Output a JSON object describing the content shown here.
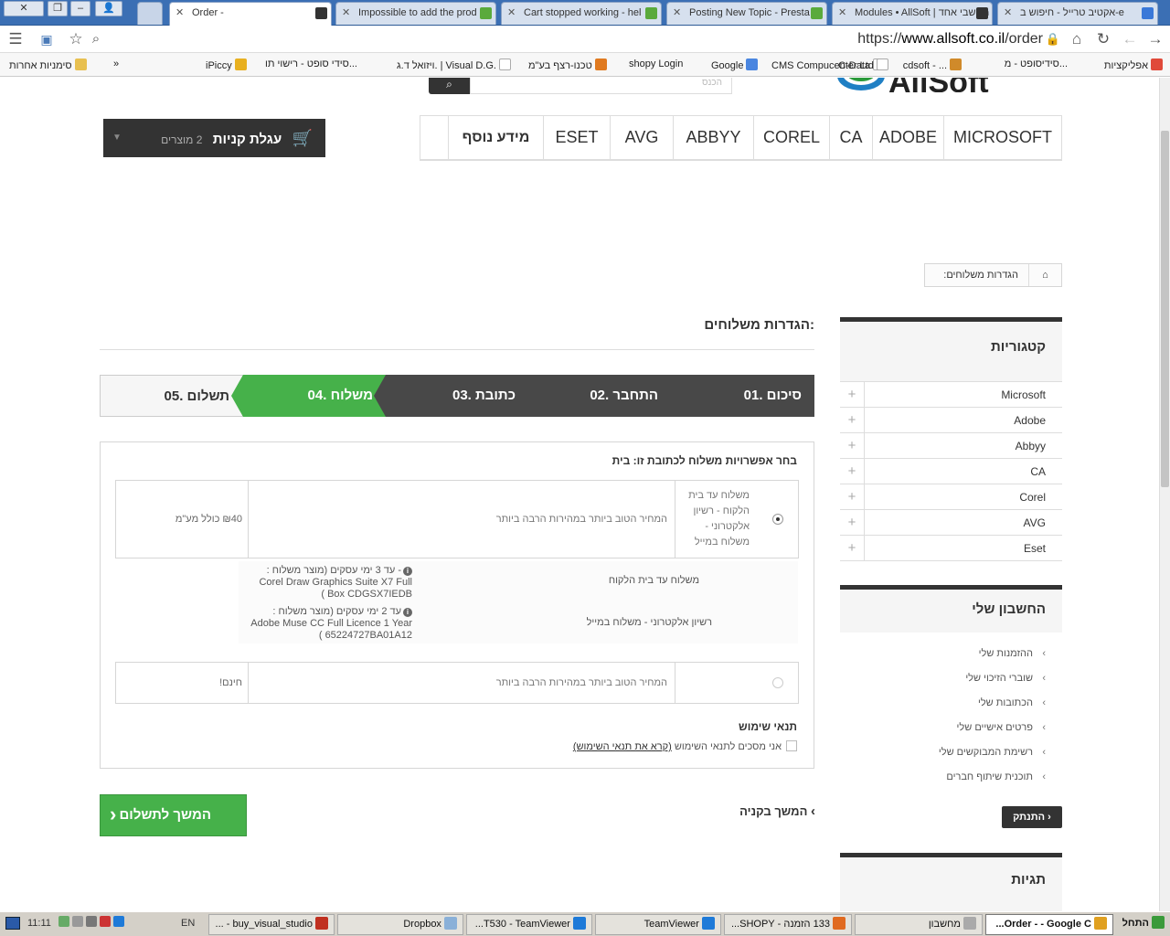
{
  "browser": {
    "tabs": [
      {
        "title": "Order -",
        "favicon": "#333333",
        "active": true
      },
      {
        "title": "Impossible to add the prod",
        "favicon": "#5aaa3c",
        "active": false
      },
      {
        "title": "Cart stopped working - hel",
        "favicon": "#5aaa3c",
        "active": false
      },
      {
        "title": "Posting New Topic - Presta",
        "favicon": "#5aaa3c",
        "active": false
      },
      {
        "title": "Modules • AllSoft | מחשבי אחד",
        "favicon": "#333333",
        "active": false
      },
      {
        "title": "אקטיב טרייל - חיפוש ב-e",
        "favicon": "#3a78d8",
        "active": false
      }
    ],
    "url_prefix": "https://",
    "url_domain": "www.allsoft.co.il",
    "url_path": "/order",
    "bookmarks": [
      {
        "label": "אפליקציות"
      },
      {
        "label": "סידיסופט - מ..."
      },
      {
        "label": "cdsoft - ..."
      },
      {
        "label": "C-Data"
      },
      {
        "label": "CMS Compucenter Ltd"
      },
      {
        "label": "Google"
      },
      {
        "label": "shopy Login"
      },
      {
        "label": "טכנו-רצף בע\"מ"
      },
      {
        "label": "ויזואל ד.ג. | Visual D.G."
      },
      {
        "label": "סידי סופט - רישוי תו..."
      },
      {
        "label": "iPiccy"
      },
      {
        "label": "»"
      },
      {
        "label": "סימניות אחרות"
      }
    ]
  },
  "header": {
    "search_placeholder": "הכנס",
    "logo_text": "AllSoft",
    "nav": [
      "MICROSOFT",
      "ADOBE",
      "CA",
      "COREL",
      "ABBYY",
      "AVG",
      "ESET",
      "מידע נוסף"
    ],
    "cart_label": "עגלת קניות",
    "cart_count": "2 מוצרים"
  },
  "breadcrumb": {
    "current": "הגדרות משלוחים:"
  },
  "page_title": "הגדרות משלוחים:",
  "steps": [
    {
      "label": "01. סיכום",
      "state": "done"
    },
    {
      "label": "02. התחבר",
      "state": "done"
    },
    {
      "label": "03. כתובת",
      "state": "done"
    },
    {
      "label": "04. משלוח",
      "state": "current"
    },
    {
      "label": "05. תשלום",
      "state": "todo"
    }
  ],
  "carriers": {
    "heading": "בחר אפשרויות משלוח לכתובת זו: בית",
    "option1": {
      "name": "משלוח עד בית הלקוח - רשיון אלקטרוני - משלוח במייל",
      "desc": "המחיר הטוב ביותר במהירות הרבה ביותר",
      "price": "₪40 כולל מע\"מ"
    },
    "details": [
      {
        "method": "משלוח עד בית הלקוח",
        "delay": "- עד 3 ימי עסקים (מוצר משלוח :",
        "product": "Corel Draw Graphics Suite X7 Full Box CDGSX7IEDB )"
      },
      {
        "method": "רשיון אלקטרוני - משלוח במייל",
        "delay": "עד 2 ימי עסקים (מוצר משלוח :",
        "product": "Adobe Muse CC Full Licence 1 Year 65224727BA01A12 )"
      }
    ],
    "option2": {
      "desc": "המחיר הטוב ביותר במהירות הרבה ביותר",
      "price": "חינם!"
    }
  },
  "terms": {
    "heading": "תנאי שימוש",
    "agree": "אני מסכים לתנאי השימוש",
    "link": "(קרא את תנאי השימוש)"
  },
  "buttons": {
    "pay": "המשך לתשלום",
    "continue": "המשך בקניה"
  },
  "sidebar": {
    "categories_title": "קטגוריות",
    "categories": [
      "Microsoft",
      "Adobe",
      "Abbyy",
      "CA",
      "Corel",
      "AVG",
      "Eset"
    ],
    "account_title": "החשבון שלי",
    "account": [
      "ההזמנות שלי",
      "שוברי הזיכוי שלי",
      "הכתובות שלי",
      "פרטים אישיים שלי",
      "רשימת המבוקשים שלי",
      "תוכנית שיתוף חברים"
    ],
    "logout": "התנתק",
    "tags_title": "תגיות"
  },
  "taskbar": {
    "start": "התחל",
    "items": [
      {
        "label": "Order - - Google C...",
        "active": true
      },
      {
        "label": "מחשבון",
        "active": false
      },
      {
        "label": "133 הזמנה - SHOPY...",
        "active": false
      },
      {
        "label": "TeamViewer",
        "active": false
      },
      {
        "label": "T530 - TeamViewer...",
        "active": false
      },
      {
        "label": "Dropbox",
        "active": false
      },
      {
        "label": "buy_visual_studio - ...",
        "active": false
      }
    ],
    "lang": "EN",
    "clock": "11:11"
  },
  "colors": {
    "accent": "#46b14a",
    "dark": "#333333",
    "tabbar": "#3b6fb4"
  }
}
